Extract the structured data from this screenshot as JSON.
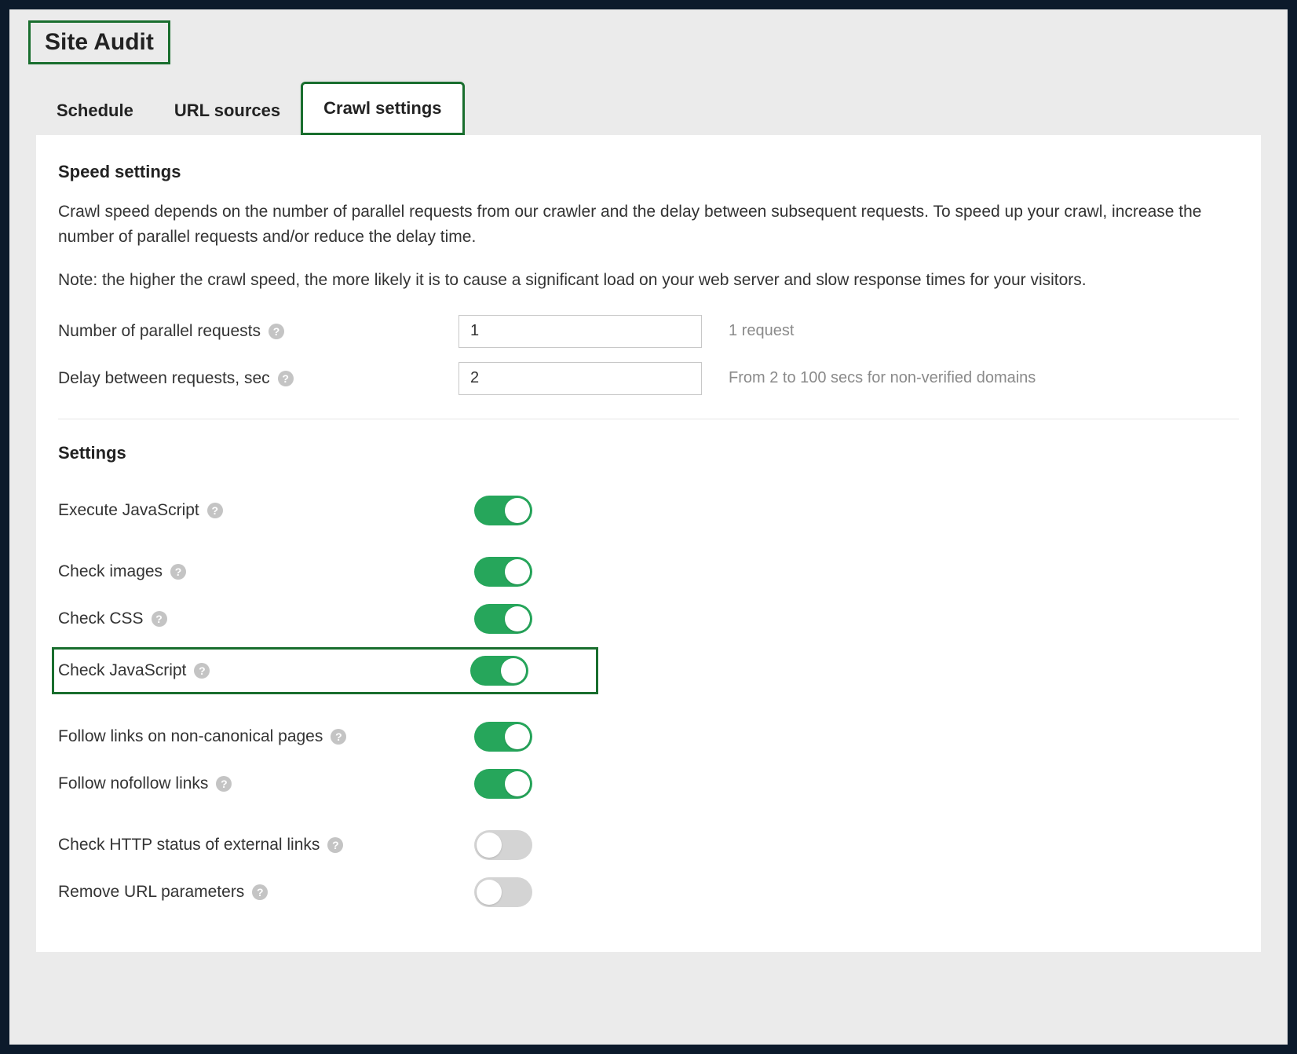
{
  "page_title": "Site Audit",
  "tabs": {
    "schedule": "Schedule",
    "url_sources": "URL sources",
    "crawl_settings": "Crawl settings"
  },
  "active_tab": "crawl_settings",
  "speed": {
    "heading": "Speed settings",
    "para1": "Crawl speed depends on the number of parallel requests from our crawler and the delay between subsequent requests. To speed up your crawl, increase the number of parallel requests and/or reduce the delay time.",
    "para2": "Note: the higher the crawl speed, the more likely it is to cause a significant load on your web server and slow response times for your visitors.",
    "parallel_label": "Number of parallel requests",
    "parallel_value": "1",
    "parallel_hint": "1 request",
    "delay_label": "Delay between requests, sec",
    "delay_value": "2",
    "delay_hint": "From 2 to 100 secs for non-verified domains"
  },
  "settings": {
    "heading": "Settings",
    "items": {
      "execute_js": {
        "label": "Execute JavaScript",
        "on": true
      },
      "check_images": {
        "label": "Check images",
        "on": true
      },
      "check_css": {
        "label": "Check CSS",
        "on": true
      },
      "check_js": {
        "label": "Check JavaScript",
        "on": true,
        "highlighted": true
      },
      "follow_noncanonical": {
        "label": "Follow links on non-canonical pages",
        "on": true
      },
      "follow_nofollow": {
        "label": "Follow nofollow links",
        "on": true
      },
      "check_http_external": {
        "label": "Check HTTP status of external links",
        "on": false
      },
      "remove_url_params": {
        "label": "Remove URL parameters",
        "on": false
      }
    }
  },
  "help_glyph": "?"
}
